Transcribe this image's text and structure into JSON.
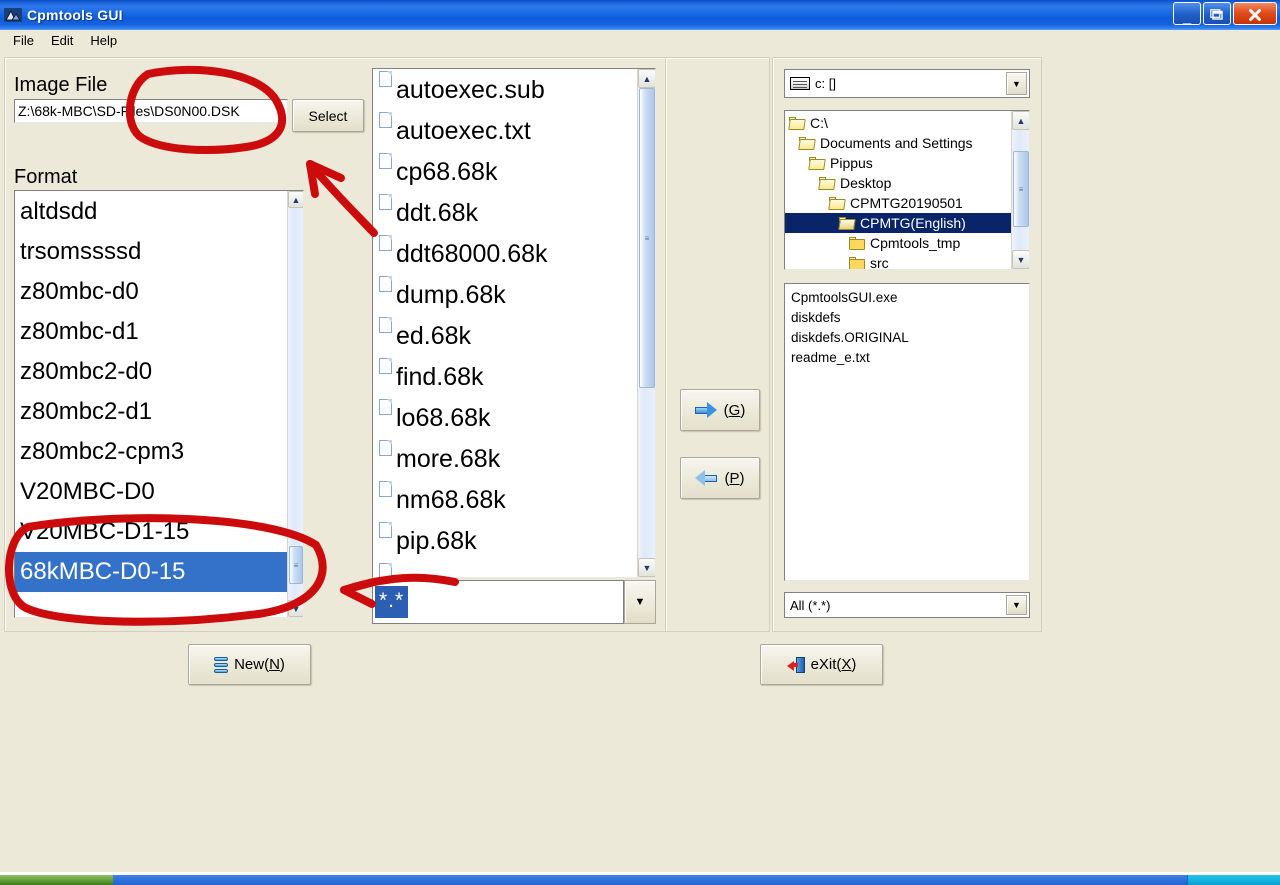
{
  "window": {
    "title": "Cpmtools GUI",
    "app_icon": "cpmtools-icon",
    "buttons": {
      "minimize": "minimize-icon",
      "maximize": "maximize-icon",
      "close": "close-icon"
    }
  },
  "menubar": {
    "items": [
      {
        "label": "File"
      },
      {
        "label": "Edit"
      },
      {
        "label": "Help"
      }
    ]
  },
  "left": {
    "image_file_label": "Image File",
    "image_file_value": "Z:\\68k-MBC\\SD-Files\\DS0N00.DSK",
    "image_file_placeholder": "",
    "select_button": "Select",
    "format_label": "Format",
    "format_items": [
      {
        "label": "altdsdd",
        "selected": false
      },
      {
        "label": "trsomssssd",
        "selected": false
      },
      {
        "label": "z80mbc-d0",
        "selected": false
      },
      {
        "label": "z80mbc-d1",
        "selected": false
      },
      {
        "label": "z80mbc2-d0",
        "selected": false
      },
      {
        "label": "z80mbc2-d1",
        "selected": false
      },
      {
        "label": "z80mbc2-cpm3",
        "selected": false
      },
      {
        "label": "V20MBC-D0",
        "selected": false
      },
      {
        "label": "V20MBC-D1-15",
        "selected": false
      },
      {
        "label": "68kMBC-D0-15",
        "selected": true
      }
    ]
  },
  "image_files": {
    "items": [
      {
        "name": "autoexec.sub",
        "icon": "document-icon"
      },
      {
        "name": "autoexec.txt",
        "icon": "document-icon"
      },
      {
        "name": "cp68.68k",
        "icon": "document-icon"
      },
      {
        "name": "ddt.68k",
        "icon": "document-icon"
      },
      {
        "name": "ddt68000.68k",
        "icon": "document-icon"
      },
      {
        "name": "dump.68k",
        "icon": "document-icon"
      },
      {
        "name": "ed.68k",
        "icon": "document-icon"
      },
      {
        "name": "find.68k",
        "icon": "document-icon"
      },
      {
        "name": "lo68.68k",
        "icon": "document-icon"
      },
      {
        "name": "more.68k",
        "icon": "document-icon"
      },
      {
        "name": "nm68.68k",
        "icon": "document-icon"
      },
      {
        "name": "pip.68k",
        "icon": "document-icon"
      }
    ],
    "mask_value": "*.*"
  },
  "transfer": {
    "get_label": "(G)",
    "get_accel": "G",
    "get_icon": "arrow-right-icon",
    "put_label": "(P)",
    "put_accel": "P",
    "put_icon": "arrow-left-icon"
  },
  "right": {
    "drive_value": "c: []",
    "drive_icon": "drive-icon",
    "tree": [
      {
        "label": "C:\\",
        "depth": 0,
        "state": "open",
        "selected": false
      },
      {
        "label": "Documents and Settings",
        "depth": 1,
        "state": "open",
        "selected": false
      },
      {
        "label": "Pippus",
        "depth": 2,
        "state": "open",
        "selected": false
      },
      {
        "label": "Desktop",
        "depth": 3,
        "state": "open",
        "selected": false
      },
      {
        "label": "CPMTG20190501",
        "depth": 4,
        "state": "open",
        "selected": false
      },
      {
        "label": "CPMTG(English)",
        "depth": 5,
        "state": "open",
        "selected": true
      },
      {
        "label": "Cpmtools_tmp",
        "depth": 6,
        "state": "closed",
        "selected": false
      },
      {
        "label": "src",
        "depth": 6,
        "state": "closed",
        "selected": false
      }
    ],
    "files": [
      {
        "name": "CpmtoolsGUI.exe"
      },
      {
        "name": "diskdefs"
      },
      {
        "name": "diskdefs.ORIGINAL"
      },
      {
        "name": "readme_e.txt"
      }
    ],
    "filter_value": "All (*.*)"
  },
  "bottom": {
    "new_label": "New(N)",
    "new_accel": "N",
    "new_icon": "disk-stack-icon",
    "exit_label": "eXit(X)",
    "exit_accel": "X",
    "exit_icon": "exit-door-icon"
  },
  "annotations": {
    "color": "#cc0c0c",
    "marks": [
      {
        "type": "ellipse",
        "target": "image-file-field"
      },
      {
        "type": "arrow",
        "target": "select-button"
      },
      {
        "type": "ellipse",
        "target": "format-selected-item"
      },
      {
        "type": "arrow",
        "target": "file-mask-combo"
      }
    ]
  },
  "taskbar": {
    "start_label": "",
    "accent": "#5f9a33"
  }
}
